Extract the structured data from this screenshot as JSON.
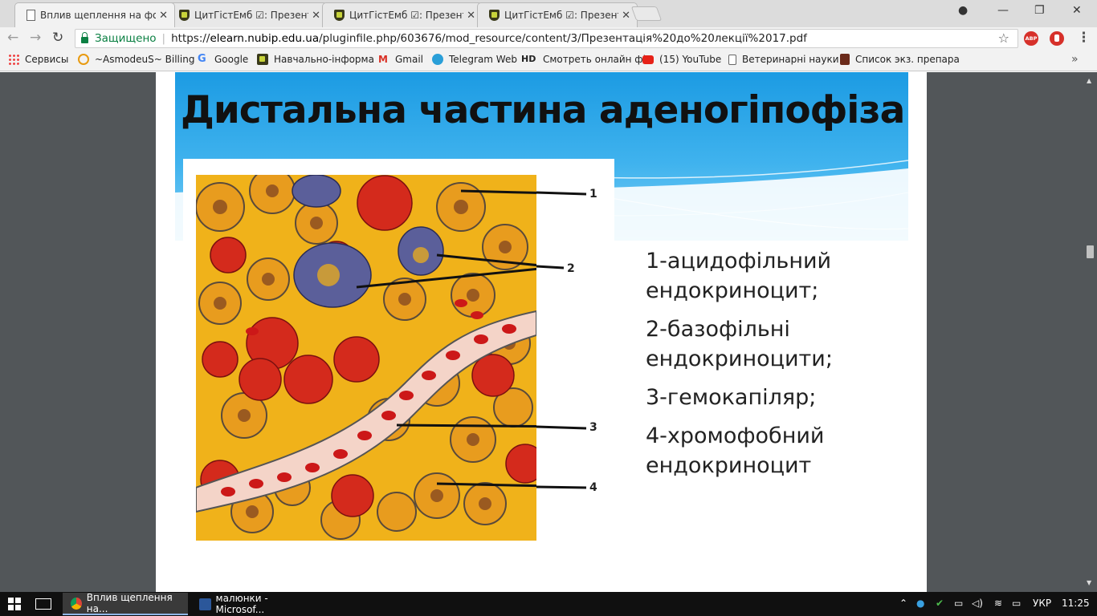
{
  "browser": {
    "tabs": [
      {
        "title": "Вплив щеплення на фор",
        "icon": "document-icon",
        "active": true
      },
      {
        "title": "ЦитГістЕмб ☑: Презент",
        "icon": "moodle-icon",
        "active": false
      },
      {
        "title": "ЦитГістЕмб ☑: Презент",
        "icon": "moodle-icon",
        "active": false
      },
      {
        "title": "ЦитГістЕмб ☑: Презент",
        "icon": "moodle-icon",
        "active": false
      }
    ],
    "address": {
      "secure_label": "Защищено",
      "scheme": "https://",
      "host": "elearn.nubip.edu.ua",
      "path": "/pluginfile.php/603676/mod_resource/content/3/Презентація%20до%20лекції%2017.pdf"
    },
    "extensions": {
      "abp_label": "ABP"
    },
    "bookmarks": [
      {
        "label": "Сервисы",
        "icon": "apps-grid-icon"
      },
      {
        "label": "~AsmodeuS~ Billing",
        "icon": "billing-icon"
      },
      {
        "label": "Google",
        "icon": "google-icon"
      },
      {
        "label": "Навчально-інформа",
        "icon": "moodle-icon"
      },
      {
        "label": "Gmail",
        "icon": "gmail-icon"
      },
      {
        "label": "Telegram Web",
        "icon": "telegram-icon"
      },
      {
        "label": "Смотреть онлайн фі",
        "icon": "hd-icon"
      },
      {
        "label": "(15) YouTube",
        "icon": "youtube-icon"
      },
      {
        "label": "Ветеринарні науки",
        "icon": "document-icon"
      },
      {
        "label": "Список экз. препара",
        "icon": "bookmark-icon"
      }
    ]
  },
  "slide": {
    "title": "Дистальна частина аденогіпофіза",
    "callout_numbers": [
      "1",
      "2",
      "3",
      "4"
    ],
    "legend": [
      "1-ацидофільний ендокриноцит;",
      "2-базофільні ендокриноцити;",
      "3-гемокапіляр;",
      "4-хромофобний ендокриноцит"
    ]
  },
  "taskbar": {
    "apps": [
      {
        "label": "Вплив щеплення на...",
        "icon": "chrome-icon",
        "active": true
      },
      {
        "label": "малюнки - Microsof...",
        "icon": "word-icon",
        "active": false
      }
    ],
    "language": "УКР",
    "time": "11:25"
  },
  "colors": {
    "banner_blue": "#1c9be3",
    "viewer_bg": "#525659",
    "acidophil_red": "#d42a1c",
    "chromophobe_yellow": "#f0b21a",
    "basophil_blue": "#5b5f9a"
  }
}
